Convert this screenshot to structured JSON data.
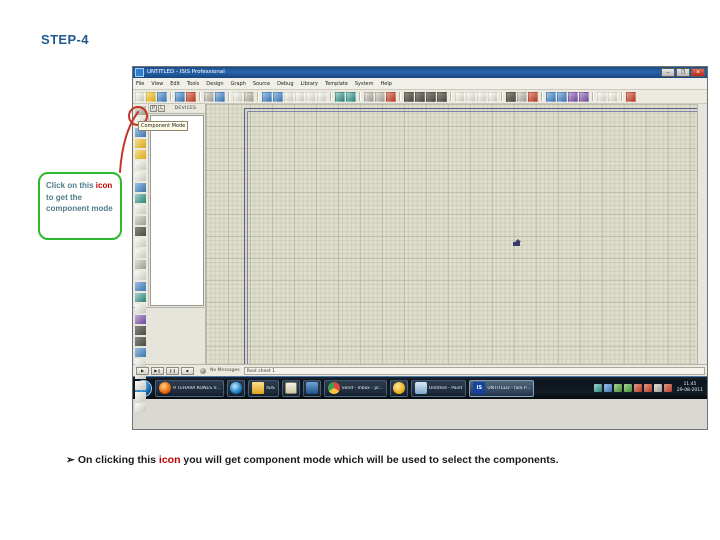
{
  "slide": {
    "title": "STEP-4",
    "bullet": {
      "arrow": "➢",
      "part1": "On clicking this ",
      "emphasis": "icon",
      "part2": " you will get component mode which will be used to select the components."
    }
  },
  "callout": {
    "line1": "Click on this ",
    "emphasis": "icon",
    "line2": " to get the component mode"
  },
  "annotation": {
    "tooltip": "Component Mode",
    "highlight_color": "#c0392b",
    "callout_border_color": "#2eb82e",
    "callout_text_color": "#4f7d8c",
    "emphasis_color": "#c00000",
    "title_color": "#1f5b8f"
  },
  "app": {
    "titlebar": {
      "text": "UNTITLED - ISIS Professional",
      "minimize": "–",
      "maximize": "❐",
      "close": "✕"
    },
    "menu": [
      "File",
      "View",
      "Edit",
      "Tools",
      "Design",
      "Graph",
      "Source",
      "Debug",
      "Library",
      "Template",
      "System",
      "Help"
    ],
    "toolbar_icons": [
      "new-file-icon",
      "open-file-icon",
      "save-file-icon",
      "import-section-icon",
      "export-section-icon",
      "print-icon",
      "print-area-icon",
      "refresh-icon",
      "grid-icon",
      "origin-icon",
      "cursor-center-icon",
      "zoom-in-icon",
      "zoom-out-icon",
      "zoom-all-icon",
      "zoom-area-icon",
      "undo-icon",
      "redo-icon",
      "cut-icon",
      "copy-icon",
      "paste-icon",
      "block-copy-icon",
      "block-move-icon",
      "block-rotate-icon",
      "block-delete-icon",
      "pick-device-icon",
      "make-device-icon",
      "packaging-tool-icon",
      "decompose-icon",
      "wire-autorouter-icon",
      "search-tag-icon",
      "property-assign-icon",
      "design-explorer-icon",
      "new-sheet-icon",
      "remove-sheet-icon",
      "exit-sheet-icon",
      "bill-of-materials-icon",
      "electrical-rules-icon",
      "netlist-transfer-icon"
    ],
    "left_tools": [
      "selection-mode-icon",
      "component-mode-icon",
      "junction-dot-icon",
      "wire-label-icon",
      "text-script-icon",
      "buses-icon",
      "subcircuit-icon",
      "terminals-mode-icon",
      "device-pins-icon",
      "graph-mode-icon",
      "tape-recorder-icon",
      "generator-mode-icon",
      "voltage-probe-icon",
      "current-probe-icon",
      "virtual-instruments-icon",
      "line-tool-icon",
      "box-tool-icon",
      "circle-tool-icon",
      "arc-tool-icon",
      "path-tool-icon",
      "text-tool-icon",
      "symbol-tool-icon",
      "marker-tool-icon",
      "rotate-clockwise-icon",
      "rotate-anticlockwise-icon",
      "rotation-angle-icon",
      "mirror-x-icon",
      "mirror-y-icon"
    ],
    "selector": {
      "pick_button": "P",
      "library_button": "L",
      "label": "DEVICES"
    },
    "simbar": {
      "play": "▶",
      "step": "▶❙",
      "pause": "❙❙",
      "stop": "■",
      "messages_label": "No Messages",
      "status": "Root sheet 1"
    }
  },
  "taskbar": {
    "start": "start-orb",
    "buttons": [
      {
        "icon": "firefox-icon",
        "label": "9 TEHARA KONES V..."
      },
      {
        "icon": "internet-explorer-icon",
        "label": ""
      },
      {
        "icon": "folder-icon",
        "label": "ISIS"
      },
      {
        "icon": "notepad-icon",
        "label": ""
      },
      {
        "icon": "download-icon",
        "label": ""
      },
      {
        "icon": "chrome-icon",
        "label": "Send - Inbox - pr..."
      },
      {
        "icon": "yellow-circle-icon",
        "label": ""
      },
      {
        "icon": "paint-icon",
        "label": "Untitled - Paint"
      },
      {
        "icon": "isis-icon",
        "label": "UNTITLED - ISIS P..."
      }
    ],
    "tray_icons": [
      "network-icon",
      "volume-icon",
      "shield-icon",
      "usb-icon",
      "antivirus-icon",
      "update-icon",
      "sync-icon",
      "power-icon"
    ],
    "clock": {
      "time": "11:45",
      "date": "29-08-2011"
    }
  }
}
